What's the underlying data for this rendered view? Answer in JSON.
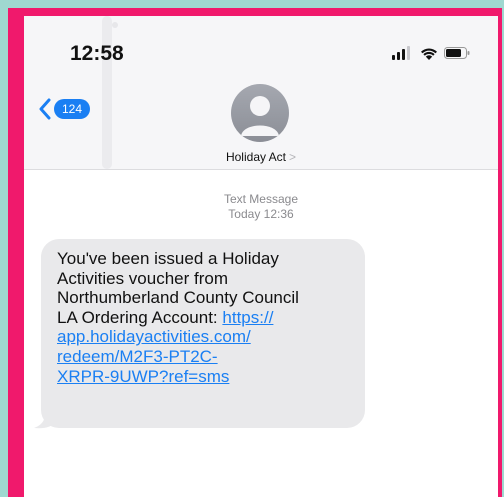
{
  "status_bar": {
    "time": "12:58"
  },
  "header": {
    "back_count": "124",
    "contact_name": "Holiday Act",
    "contact_chevron": ">"
  },
  "thread": {
    "kind": "Text Message",
    "timestamp": "Today 12:36"
  },
  "message": {
    "lines": [
      "You've been issued a Holiday",
      "Activities voucher from",
      "Northumberland County Council",
      "LA Ordering Account: "
    ],
    "link_lines": [
      "https://",
      "app.holidayactivities.com/",
      "redeem/M2F3-PT2C-",
      "XRPR-9UWP?ref=sms"
    ]
  },
  "colors": {
    "frame_border": "#f0196c",
    "outer_background": "#9fd8d0",
    "accent_blue": "#1a7ff3",
    "bubble_gray": "#e9e9eb"
  },
  "icons": [
    "signal-icon",
    "wifi-icon",
    "battery-icon",
    "chevron-left-icon",
    "avatar"
  ]
}
